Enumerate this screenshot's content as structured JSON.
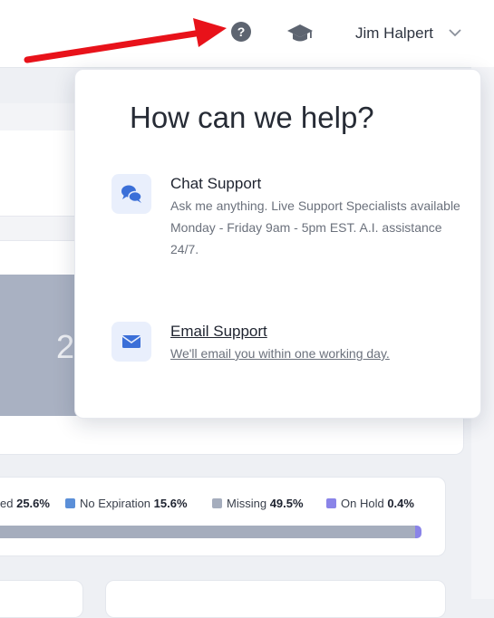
{
  "header": {
    "user_name": "Jim Halpert",
    "help_icon_glyph": "?",
    "icons": [
      "help-circle-icon",
      "graduation-cap-icon",
      "chevron-down-icon"
    ]
  },
  "background": {
    "partial_number": "2",
    "legend": [
      {
        "label": "ed",
        "value": "25.6%",
        "color": ""
      },
      {
        "label": "No Expiration",
        "value": "15.6%",
        "color": "#5b8fd8"
      },
      {
        "label": "Missing",
        "value": "49.5%",
        "color": "#a5adbd"
      },
      {
        "label": "On Hold",
        "value": "0.4%",
        "color": "#8a84e8"
      }
    ]
  },
  "popover": {
    "title": "How can we help?",
    "chat": {
      "title": "Chat Support",
      "description": "Ask me anything. Live Support Specialists available Monday - Friday 9am - 5pm EST. A.I. assistance 24/7.",
      "icon": "chat-bubbles-icon"
    },
    "email": {
      "title": "Email Support",
      "description": "We'll email you within one working day.",
      "icon": "envelope-icon"
    }
  },
  "colors": {
    "accent": "#3b6fd8",
    "icon_bg": "#e9effc",
    "arrow": "#e8121a"
  }
}
